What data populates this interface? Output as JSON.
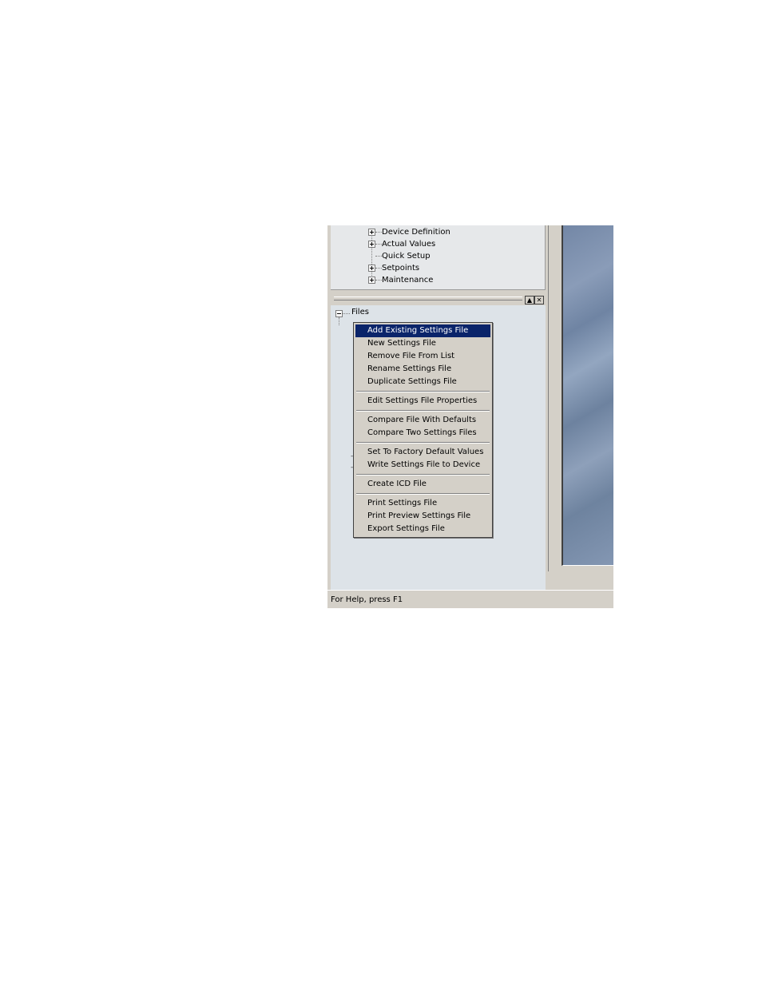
{
  "tree": {
    "items": [
      {
        "label": "Device Definition",
        "expandable": true
      },
      {
        "label": "Actual Values",
        "expandable": true
      },
      {
        "label": "Quick Setup",
        "expandable": false
      },
      {
        "label": "Setpoints",
        "expandable": true
      },
      {
        "label": "Maintenance",
        "expandable": true
      }
    ]
  },
  "pane_buttons": {
    "up": "▲",
    "close": "✕"
  },
  "files_tree": {
    "root_label": "Files"
  },
  "context_menu": {
    "groups": [
      [
        "Add Existing Settings File",
        "New Settings File",
        "Remove File From List",
        "Rename Settings File",
        "Duplicate Settings File"
      ],
      [
        "Edit Settings File Properties"
      ],
      [
        "Compare File With Defaults",
        "Compare Two Settings Files"
      ],
      [
        "Set To Factory Default Values",
        "Write Settings File to Device"
      ],
      [
        "Create ICD File"
      ],
      [
        "Print Settings File",
        "Print Preview Settings File",
        "Export Settings File"
      ]
    ],
    "selected": "Add Existing Settings File"
  },
  "status_bar": {
    "text": "For Help, press F1"
  }
}
